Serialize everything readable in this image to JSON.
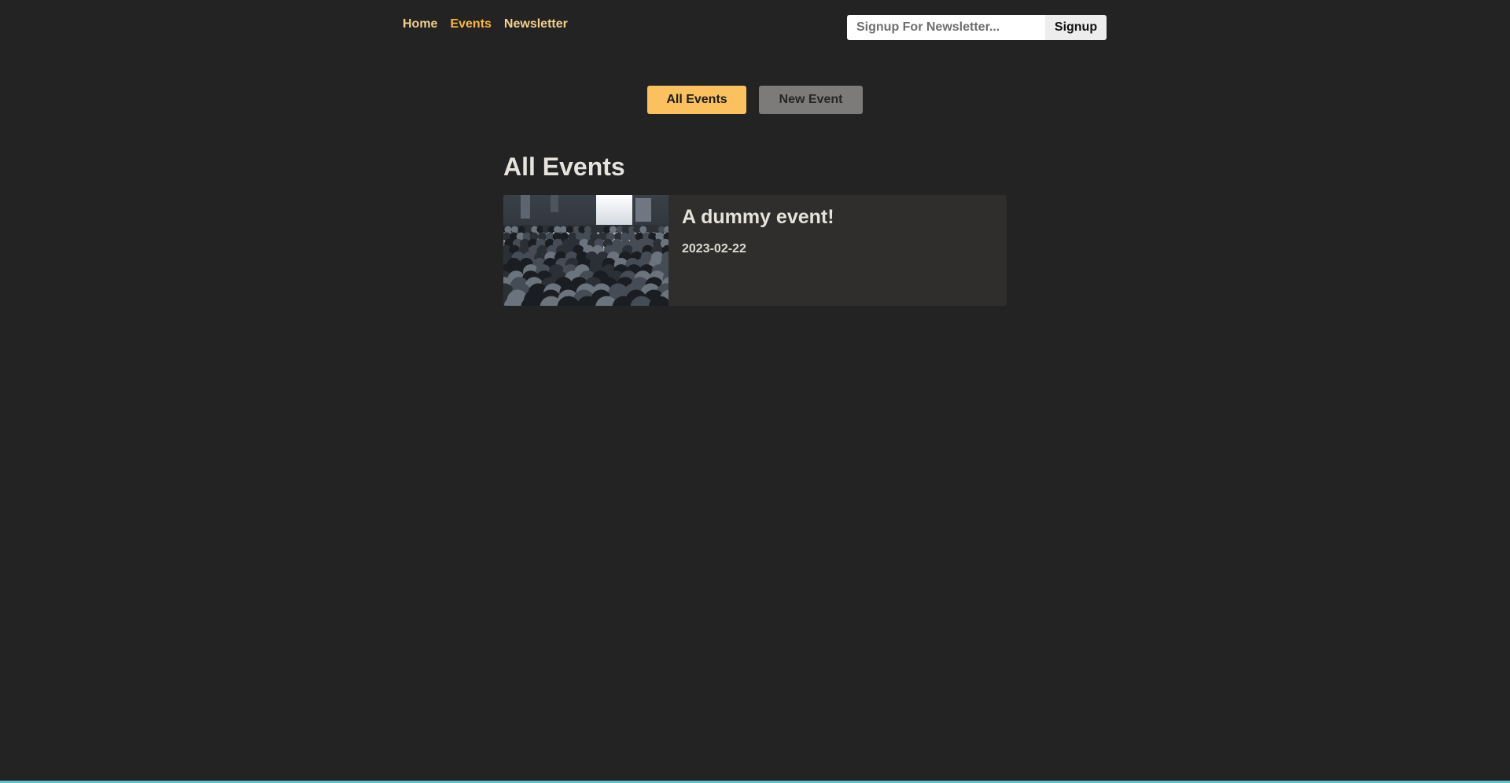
{
  "nav": {
    "links": [
      {
        "label": "Home"
      },
      {
        "label": "Events"
      },
      {
        "label": "Newsletter"
      }
    ]
  },
  "newsletter": {
    "placeholder": "Signup For Newsletter...",
    "value": "",
    "button_label": "Signup"
  },
  "events_nav": {
    "all_events_label": "All Events",
    "new_event_label": "New Event"
  },
  "page": {
    "title": "All Events"
  },
  "events": [
    {
      "title": "A dummy event!",
      "date": "2023-02-22",
      "image_icon": "crowd-photo"
    }
  ],
  "colors": {
    "background": "#232323",
    "accent": "#fbc15e",
    "nav_link": "#f3d08a",
    "nav_active": "#f7b63f",
    "secondary_button": "#7d7b79",
    "card_background": "#2f2e2c",
    "text_light": "#e6e3dc"
  }
}
